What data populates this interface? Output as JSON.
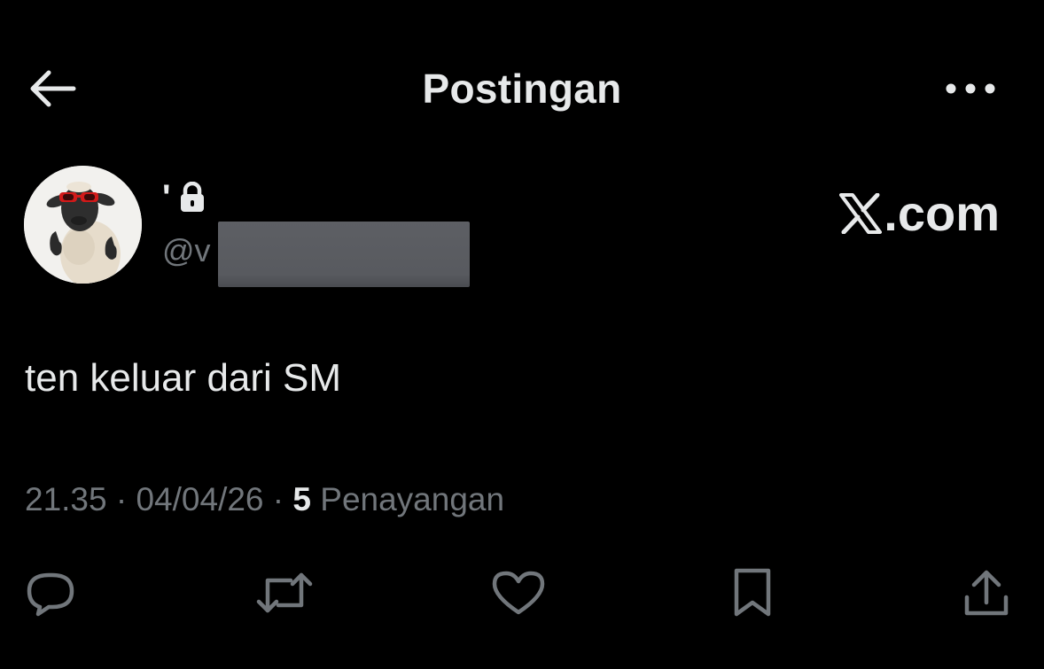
{
  "header": {
    "title": "Postingan",
    "back_icon": "arrow-left-icon",
    "more_icon": "ellipsis-icon"
  },
  "author": {
    "display_name": "'",
    "handle_visible": "@v",
    "protected_icon": "lock-icon",
    "avatar": "sheep-avatar-with-red-sunglasses"
  },
  "watermark": {
    "text": ".com",
    "logo_letter": "X"
  },
  "post": {
    "text": "ten keluar dari SM",
    "time": "21.35",
    "separator": " · ",
    "date": "04/04/26",
    "views_count": "5",
    "views_label": "Penayangan"
  },
  "actions": [
    {
      "name": "reply",
      "icon": "speech-bubble-icon"
    },
    {
      "name": "repost",
      "icon": "repost-arrows-icon"
    },
    {
      "name": "like",
      "icon": "heart-icon"
    },
    {
      "name": "bookmark",
      "icon": "bookmark-icon"
    },
    {
      "name": "share",
      "icon": "share-upload-icon"
    }
  ],
  "colors": {
    "background": "#000000",
    "primary_text": "#e7e9ea",
    "secondary_text": "#71767b",
    "redaction": "#5b5d62"
  }
}
